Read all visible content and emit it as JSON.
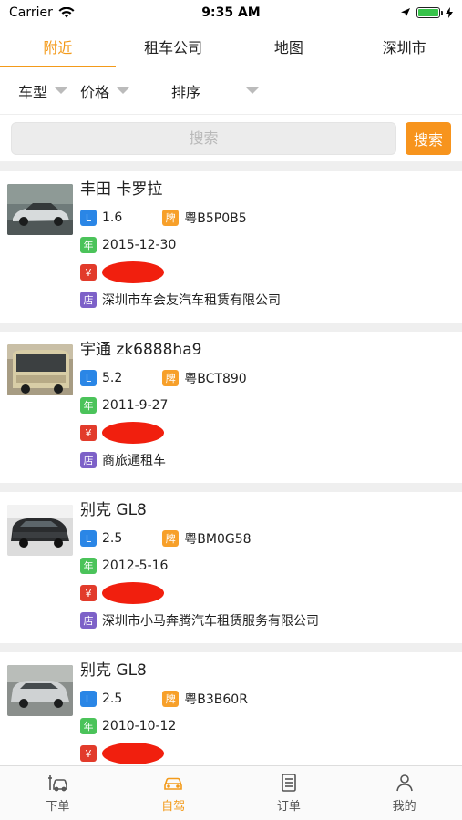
{
  "status": {
    "carrier": "Carrier",
    "time": "9:35 AM"
  },
  "tabs": [
    {
      "label": "附近",
      "active": true
    },
    {
      "label": "租车公司",
      "active": false
    },
    {
      "label": "地图",
      "active": false
    },
    {
      "label": "深圳市",
      "active": false
    }
  ],
  "filters": {
    "car_type": "车型",
    "price": "价格",
    "sort": "排序"
  },
  "search": {
    "placeholder": "搜索",
    "button_label": "搜索"
  },
  "badges": {
    "engine": "L",
    "plate": "牌",
    "year": "年",
    "price": "¥",
    "shop": "店"
  },
  "cars": [
    {
      "name": "丰田 卡罗拉",
      "engine": "1.6",
      "plate": "粤B5P0B5",
      "date": "2015-12-30",
      "shop": "深圳市车会友汽车租赁有限公司"
    },
    {
      "name": "宇通 zk6888ha9",
      "engine": "5.2",
      "plate": "粤BCT890",
      "date": "2011-9-27",
      "shop": "商旅通租车"
    },
    {
      "name": "别克 GL8",
      "engine": "2.5",
      "plate": "粤BM0G58",
      "date": "2012-5-16",
      "shop": "深圳市小马奔腾汽车租赁服务有限公司"
    },
    {
      "name": "别克 GL8",
      "engine": "2.5",
      "plate": "粤B3B60R",
      "date": "2010-10-12",
      "shop": ""
    }
  ],
  "tabbar": [
    {
      "label": "下单",
      "active": false
    },
    {
      "label": "自驾",
      "active": true
    },
    {
      "label": "订单",
      "active": false
    },
    {
      "label": "我的",
      "active": false
    }
  ],
  "colors": {
    "accent": "#f39a1a",
    "search_button": "#f7941d",
    "price_mask": "#f11f0e"
  }
}
